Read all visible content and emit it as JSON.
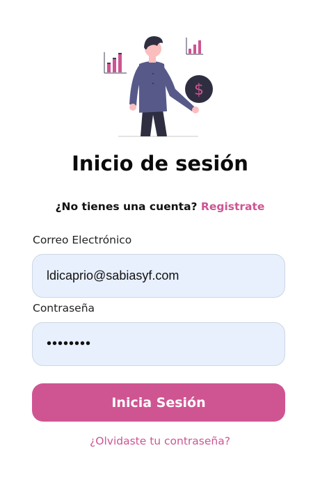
{
  "page": {
    "title": "Inicio de sesión",
    "signup_prompt": "¿No tienes una cuenta?",
    "signup_link": "Registrate"
  },
  "form": {
    "email_label": "Correo Electrónico",
    "email_value": "ldicaprio@sabiasyf.com",
    "password_label": "Contraseña",
    "password_value": "••••••••",
    "submit_label": "Inicia Sesión",
    "forgot_label": "¿Olvidaste tu contraseña?"
  },
  "colors": {
    "accent": "#cf5592",
    "input_bg": "#e8f0fe",
    "illustration_shirt": "#575a89",
    "illustration_coin": "#2f2e41"
  },
  "illustration": {
    "icons": [
      "bar-chart-icon",
      "person-illustration",
      "dollar-coin-icon",
      "small-chart-icon"
    ]
  }
}
